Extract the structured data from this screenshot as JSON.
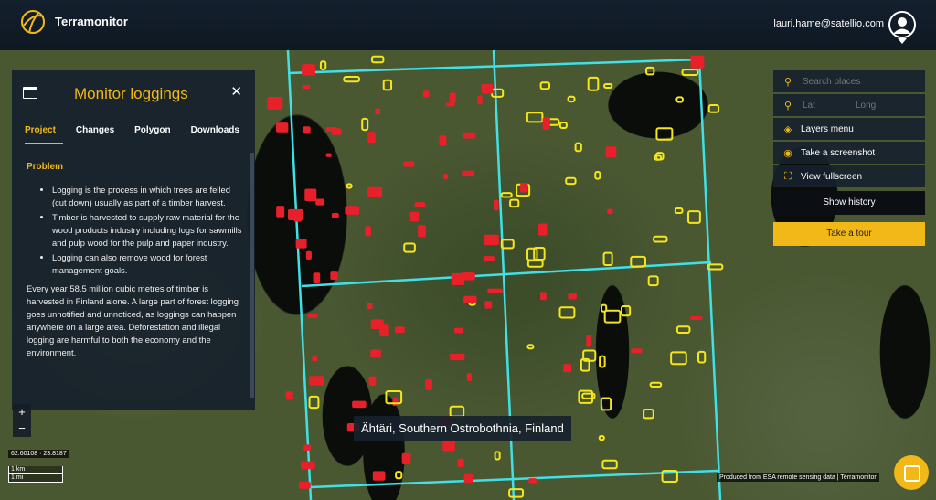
{
  "app": {
    "name": "Terramonitor",
    "user_email": "lauri.hame@satellio.com"
  },
  "panel": {
    "title": "Monitor loggings",
    "tabs": [
      "Project",
      "Changes",
      "Polygon",
      "Downloads"
    ],
    "active_tab": "Project",
    "section_title": "Problem",
    "bullets": [
      "Logging is the process in which trees are felled (cut down) usually as part of a timber harvest.",
      "Timber is harvested to supply raw material for the wood products industry including logs for sawmills and pulp wood for the pulp and paper industry.",
      "Logging can also remove wood for forest management goals."
    ],
    "paragraph": "Every year 58.5 million cubic metres of timber is harvested in Finland alone. A large part of forest logging goes unnotified and unnoticed, as loggings can happen anywhere on a large area. Deforestation and illegal logging are harmful to both the economy and the environment."
  },
  "map": {
    "coords": "62.60108 · 23.8187",
    "scale_km": "1 km",
    "scale_mi": "1 mi",
    "location": "Ähtäri, Southern Ostrobothnia, Finland",
    "attribution": "Produced from ESA remote sensing data | Terramonitor",
    "colors": {
      "grid": "#3fe0e6",
      "cleared": "#e8202a",
      "logging": "#f5e61c"
    }
  },
  "right_menu": {
    "search_placeholder": "Search places",
    "lat_placeholder": "Lat",
    "long_placeholder": "Long",
    "layers": "Layers menu",
    "screenshot": "Take a screenshot",
    "fullscreen": "View fullscreen",
    "show_history": "Show history",
    "take_tour": "Take a tour"
  },
  "colors": {
    "accent": "#f2b817",
    "panel_bg": "#16212c"
  }
}
